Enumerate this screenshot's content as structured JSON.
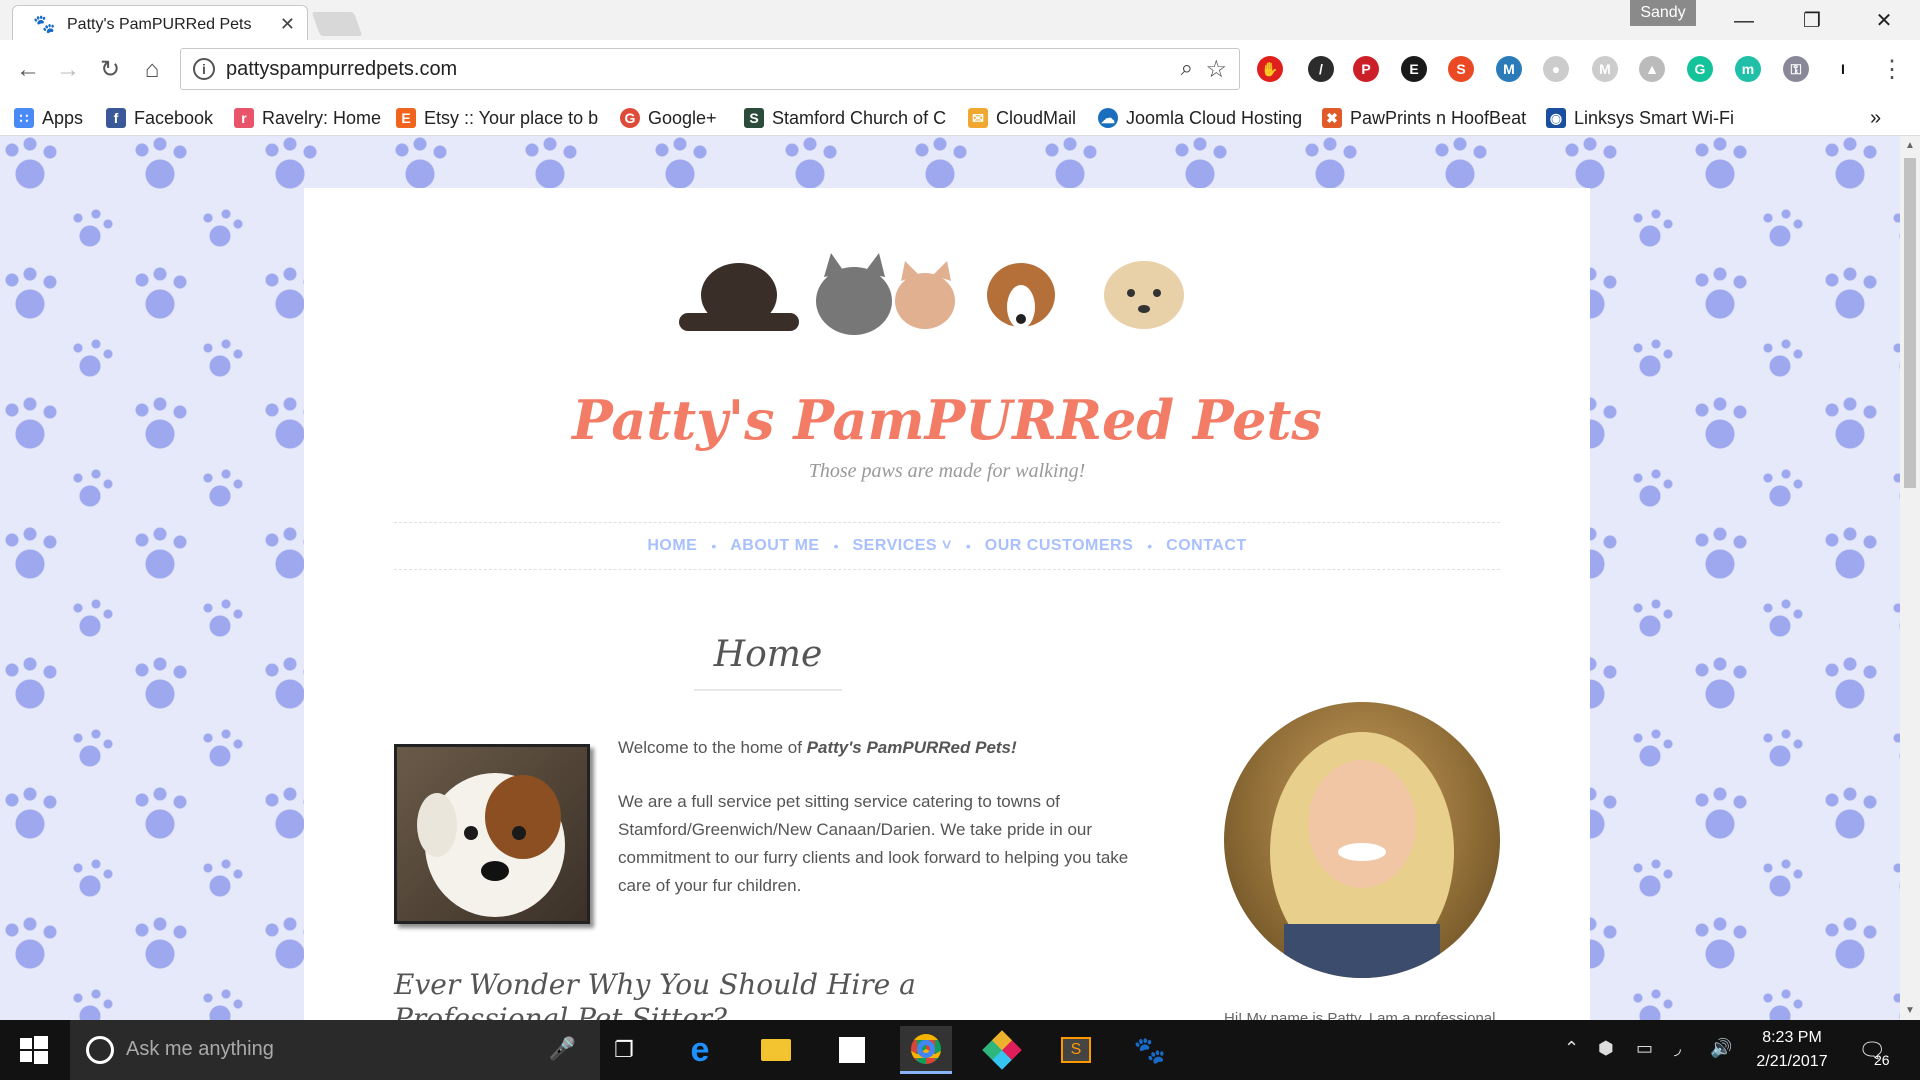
{
  "browser": {
    "tab_title": "Patty's PamPURRed Pets",
    "user": "Sandy",
    "url": "pattyspampurredpets.com"
  },
  "bookmarks": [
    {
      "label": "Apps",
      "color": "#4a8af4"
    },
    {
      "label": "Facebook",
      "color": "#3b5998"
    },
    {
      "label": "Ravelry: Home",
      "color": "#e8546a"
    },
    {
      "label": "Etsy :: Your place to b",
      "color": "#f1641e"
    },
    {
      "label": "Google+",
      "color": "#dd4b39"
    },
    {
      "label": "Stamford Church of C",
      "color": "#2c4c3b"
    },
    {
      "label": "CloudMail",
      "color": "#f0a830"
    },
    {
      "label": "Joomla Cloud Hosting",
      "color": "#1a6fbd"
    },
    {
      "label": "PawPrints n HoofBeat",
      "color": "#e05a2a"
    },
    {
      "label": "Linksys Smart Wi-Fi",
      "color": "#1a4fa0"
    }
  ],
  "site": {
    "title": "Patty's PamPURRed Pets",
    "tagline": "Those paws are made for walking!",
    "nav": [
      "HOME",
      "ABOUT ME",
      "SERVICES ˅",
      "OUR CUSTOMERS",
      "CONTACT"
    ],
    "page_heading": "Home",
    "welcome_prefix": "Welcome to the home of ",
    "welcome_bold": "Patty's PamPURRed Pets!",
    "body_para": "We are a full service pet sitting service catering to towns of Stamford/Greenwich/New Canaan/Darien. We take pride in our commitment to our furry clients and look forward to helping you take care of your fur children.",
    "subheading": "Ever Wonder Why You Should Hire a Professional Pet Sitter?",
    "side_text": "Hi! My name is Patty. I am a professional pet sitter. When I am not taking care of other people's pets, I enjoy baking with"
  },
  "taskbar": {
    "search_placeholder": "Ask me anything",
    "time": "8:23 PM",
    "date": "2/21/2017",
    "notifications": "26"
  }
}
